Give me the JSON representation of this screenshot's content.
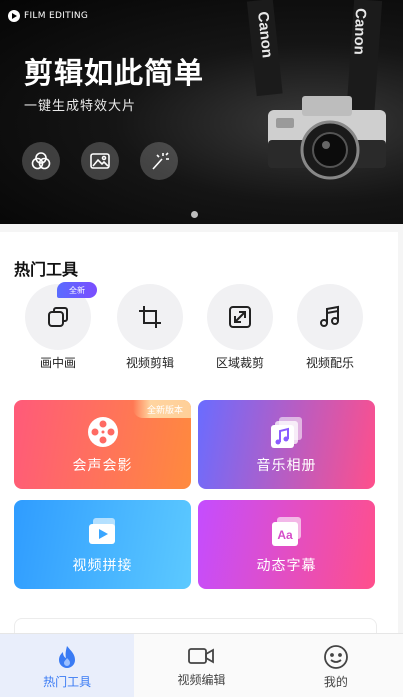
{
  "hero": {
    "badge": "FILM  EDITING",
    "title": "剪辑如此简单",
    "subtitle": "一键生成特效大片",
    "icons": [
      "filter-icon",
      "image-icon",
      "magic-wand-icon"
    ],
    "camera_brand": "Canon"
  },
  "tools_section": {
    "title": "热门工具",
    "items": [
      {
        "label": "画中画",
        "icon": "picture-in-picture-icon",
        "tag": "全新"
      },
      {
        "label": "视频剪辑",
        "icon": "crop-icon"
      },
      {
        "label": "区域裁剪",
        "icon": "resize-icon"
      },
      {
        "label": "视频配乐",
        "icon": "music-note-icon"
      }
    ]
  },
  "feature_cards": [
    {
      "label": "会声会影",
      "icon": "film-reel-icon",
      "tag": "全新版本",
      "colors": [
        "#ff5a7a",
        "#ff8a3d"
      ]
    },
    {
      "label": "音乐相册",
      "icon": "music-album-icon",
      "colors": [
        "#6a6cff",
        "#ff4f8b"
      ]
    },
    {
      "label": "视频拼接",
      "icon": "video-stack-icon",
      "colors": [
        "#2f9cff",
        "#5cc9ff"
      ]
    },
    {
      "label": "动态字幕",
      "icon": "subtitle-icon",
      "colors": [
        "#c44dff",
        "#ff4f8b"
      ]
    }
  ],
  "bottom_nav": {
    "items": [
      {
        "label": "热门工具",
        "icon": "flame-icon",
        "active": true
      },
      {
        "label": "视频编辑",
        "icon": "video-camera-icon",
        "active": false
      },
      {
        "label": "我的",
        "icon": "smiley-icon",
        "active": false
      }
    ]
  }
}
